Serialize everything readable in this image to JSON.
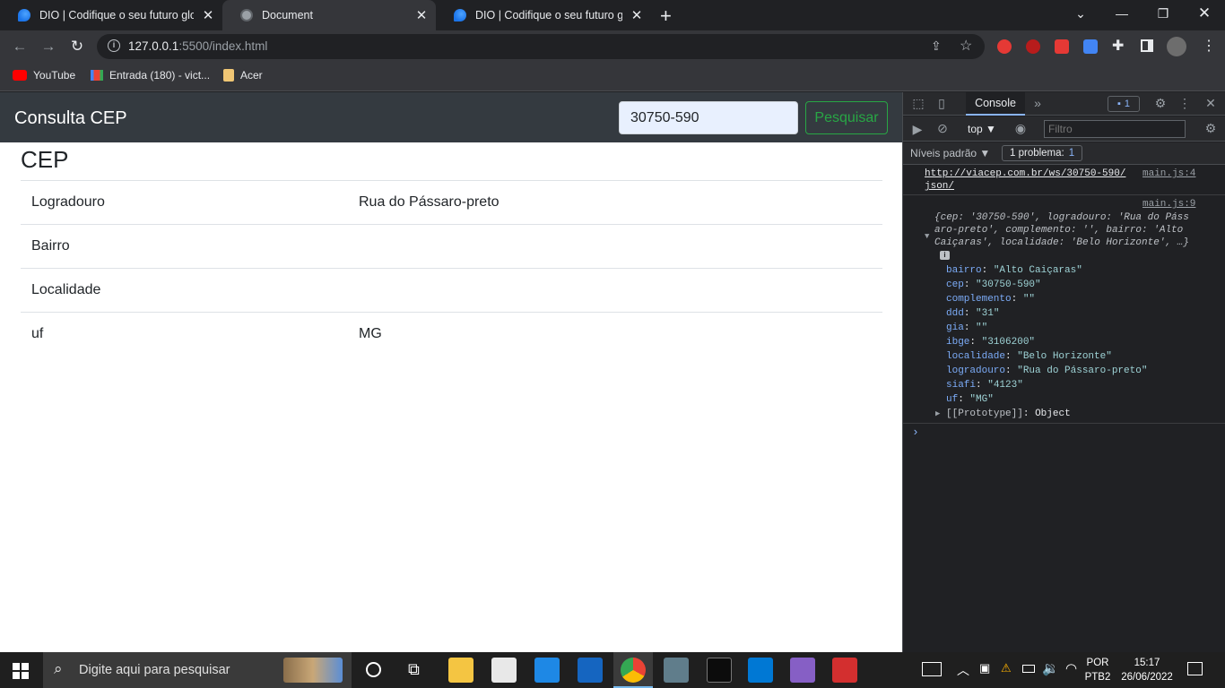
{
  "browser": {
    "tabs": [
      {
        "title": "DIO | Codifique o seu futuro glob",
        "close": "✕"
      },
      {
        "title": "Document",
        "close": "✕"
      },
      {
        "title": "DIO | Codifique o seu futuro glob",
        "close": "✕"
      }
    ],
    "new_tab": "+",
    "url_host": "127.0.0.1",
    "url_path": ":5500/index.html",
    "bookmarks": [
      "YouTube",
      "Entrada (180) - vict...",
      "Acer"
    ]
  },
  "page": {
    "brand": "Consulta CEP",
    "search_value": "30750-590",
    "search_button": "Pesquisar",
    "result_title": "CEP",
    "rows": [
      {
        "label": "Logradouro",
        "value": "Rua do Pássaro-preto"
      },
      {
        "label": "Bairro",
        "value": ""
      },
      {
        "label": "Localidade",
        "value": ""
      },
      {
        "label": "uf",
        "value": "MG"
      }
    ]
  },
  "devtools": {
    "tab": "Console",
    "issues_count": "1",
    "context": "top ▼",
    "filter_placeholder": "Filtro",
    "levels": "Níveis padrão ▼",
    "problems": "1 problema:",
    "problems_count": "1",
    "log1_url": "http://viacep.com.br/ws/30750-590/",
    "log1_url2": "json/",
    "log1_src": "main.js:4",
    "log2_src": "main.js:9",
    "preview_lines": [
      "{cep: '30750-590', logradouro: 'Rua do Páss",
      "aro-preto', complemento: '', bairro: 'Alto",
      "Caiçaras', localidade: 'Belo Horizonte', …}"
    ],
    "props": [
      {
        "key": "bairro",
        "value": "\"Alto Caiçaras\""
      },
      {
        "key": "cep",
        "value": "\"30750-590\""
      },
      {
        "key": "complemento",
        "value": "\"\""
      },
      {
        "key": "ddd",
        "value": "\"31\""
      },
      {
        "key": "gia",
        "value": "\"\""
      },
      {
        "key": "ibge",
        "value": "\"3106200\""
      },
      {
        "key": "localidade",
        "value": "\"Belo Horizonte\""
      },
      {
        "key": "logradouro",
        "value": "\"Rua do Pássaro-preto\""
      },
      {
        "key": "siafi",
        "value": "\"4123\""
      },
      {
        "key": "uf",
        "value": "\"MG\""
      }
    ],
    "prototype_key": "[[Prototype]]",
    "prototype_value": "Object"
  },
  "taskbar": {
    "search_placeholder": "Digite aqui para pesquisar",
    "lang1": "POR",
    "lang2": "PTB2",
    "time": "15:17",
    "date": "26/06/2022"
  }
}
